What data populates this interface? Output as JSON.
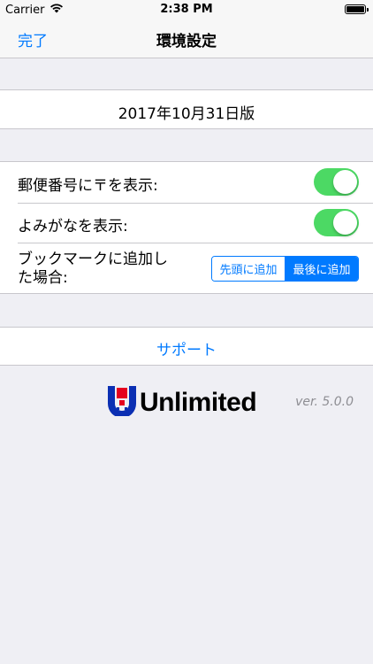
{
  "status_bar": {
    "carrier": "Carrier",
    "time": "2:38 PM"
  },
  "nav": {
    "done_label": "完了",
    "title": "環境設定"
  },
  "version_cell": {
    "text": "2017年10月31日版"
  },
  "settings": {
    "postal_label": "郵便番号に〒を表示:",
    "postal_on": true,
    "reading_label": "よみがなを表示:",
    "reading_on": true,
    "bookmark_label_line1": "ブックマークに追加し",
    "bookmark_label_line2": "た場合:",
    "segments": [
      "先頭に追加",
      "最後に追加"
    ],
    "selected_segment": "最後に追加"
  },
  "support": {
    "label": "サポート"
  },
  "footer": {
    "logo_text": "Unlimited",
    "version": "ver. 5.0.0"
  },
  "colors": {
    "accent": "#007aff",
    "toggle_on": "#4cd964",
    "background": "#efeff4",
    "logo_blue": "#0b2fb3",
    "logo_red": "#e6001e"
  }
}
